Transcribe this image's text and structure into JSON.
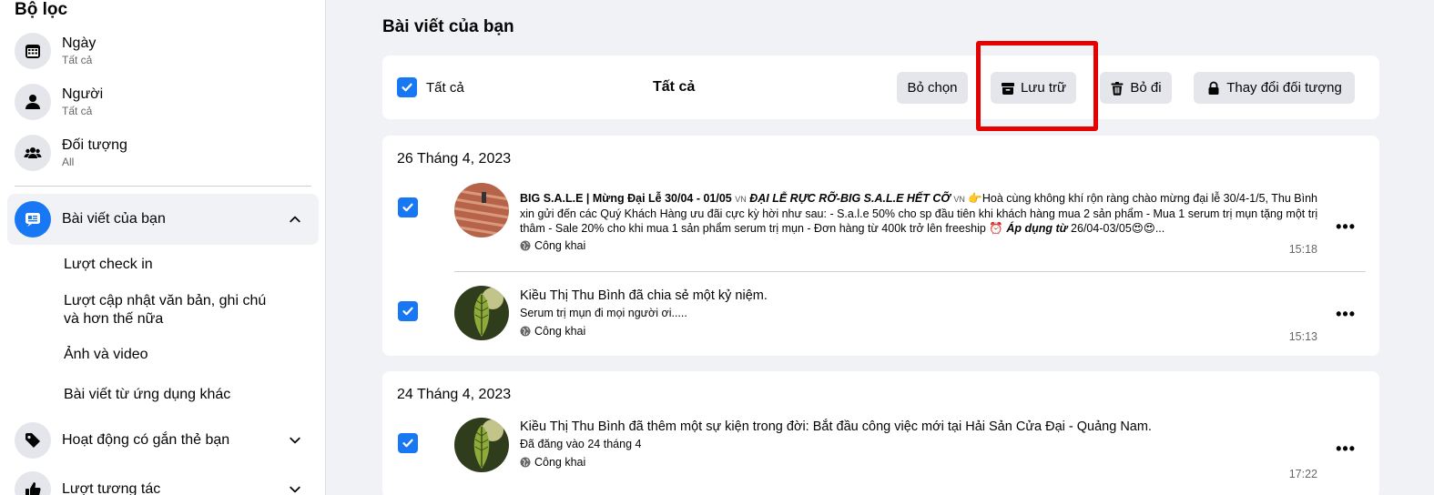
{
  "sidebar": {
    "title": "Bộ lọc",
    "filters": [
      {
        "label": "Ngày",
        "sub": "Tất cả",
        "icon": "calendar-icon"
      },
      {
        "label": "Người",
        "sub": "Tất cả",
        "icon": "person-icon"
      },
      {
        "label": "Đối tượng",
        "sub": "All",
        "icon": "people-icon"
      }
    ],
    "active_nav": {
      "label": "Bài viết của bạn",
      "icon": "post-icon"
    },
    "sub_items": [
      "Lượt check in",
      "Lượt cập nhật văn bản, ghi chú và hơn thế nữa",
      "Ảnh và video",
      "Bài viết từ ứng dụng khác"
    ],
    "nav_tagged": {
      "label": "Hoạt động có gắn thẻ bạn",
      "icon": "tag-icon"
    },
    "nav_reactions": {
      "label": "Lượt tương tác",
      "icon": "like-icon"
    }
  },
  "main": {
    "title": "Bài viết của bạn",
    "toolbar": {
      "select_all_label": "Tất cả",
      "center_label": "Tất cả",
      "deselect_label": "Bỏ chọn",
      "archive_label": "Lưu trữ",
      "trash_label": "Bỏ đi",
      "audience_label": "Thay đổi đối tượng"
    },
    "groups": [
      {
        "date": "26 Tháng 4, 2023",
        "posts": [
          {
            "main_pre": "BIG S.A.L.E | Mừng Đại Lễ 30/04 - 01/05 ",
            "main_vn1": "VN",
            "main_mid": " ĐẠI LỄ RỰC RỠ-BIG S.A.L.E HẾT CỠ ",
            "main_vn2": "VN",
            "main_post": " 👉Hoà cùng không khí rộn ràng chào mừng đại lễ 30/4-1/5, Thu Bình xin gửi đến các Quý Khách Hàng ưu đãi cực kỳ hời như sau: - S.a.l.e 50% cho sp đầu tiên khi khách hàng mua 2 sản phẩm - Mua 1 serum trị mụn tặng một trị thâm - Sale 20% cho khi mua 1 sản phẩm serum trị mụn - Đơn hàng từ 400k trở lên freeship ⏰ ",
            "main_bold2": "Áp dụng từ",
            "main_end": " 26/04-03/05😍😍...",
            "privacy": "Công khai",
            "time": "15:18"
          },
          {
            "author": "Kiều Thị Thu Bình",
            "action": " đã chia sẻ một kỷ niệm.",
            "snippet": "Serum trị mụn đi mọi người ơi.....",
            "privacy": "Công khai",
            "time": "15:13"
          }
        ]
      },
      {
        "date": "24 Tháng 4, 2023",
        "posts": [
          {
            "author": "Kiều Thị Thu Bình",
            "action": " đã thêm một sự kiện trong đời: ",
            "event": "Bắt đầu công việc mới tại Hải Sản Cửa Đại - Quảng Nam.",
            "snippet": "Đã đăng vào 24 tháng 4",
            "privacy": "Công khai",
            "time": "17:22"
          }
        ]
      }
    ],
    "more_label": "•••"
  },
  "colors": {
    "accent": "#1877f2",
    "highlight": "#e60000",
    "button_bg": "#e4e6eb"
  }
}
